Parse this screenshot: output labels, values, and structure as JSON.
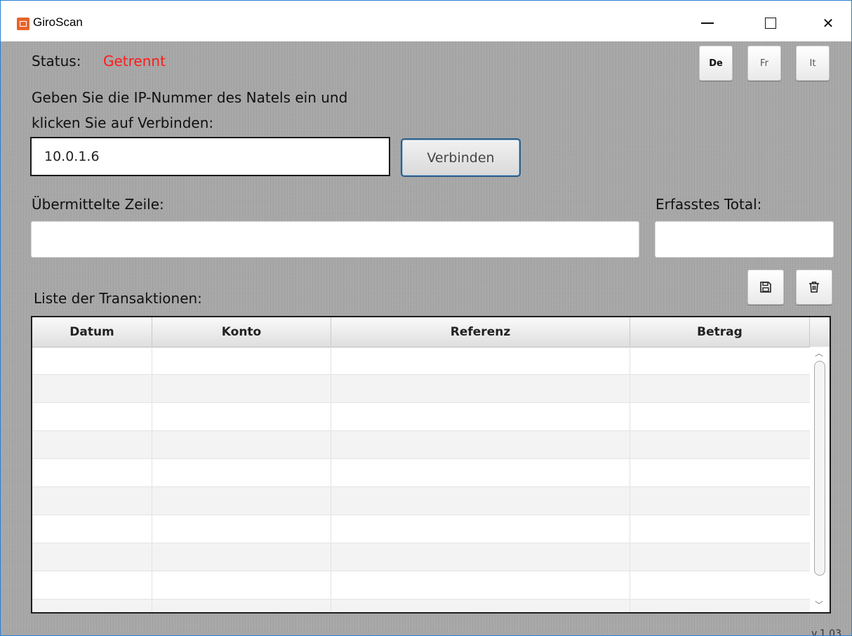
{
  "window": {
    "title": "GiroScan",
    "controls": {
      "minimize": "minimize",
      "maximize": "maximize",
      "close": "close"
    }
  },
  "status": {
    "label": "Status:",
    "value": "Getrennt",
    "value_color": "#ff1a1a"
  },
  "languages": [
    {
      "label": "De",
      "active": true
    },
    {
      "label": "Fr",
      "active": false
    },
    {
      "label": "It",
      "active": false
    }
  ],
  "instructions": {
    "line1": "Geben Sie die IP-Nummer des Natels ein und",
    "line2": "klicken Sie auf Verbinden:"
  },
  "ip_input": {
    "value": "10.0.1.6"
  },
  "connect_button": {
    "label": "Verbinden"
  },
  "transmitted_line": {
    "label": "Übermittelte Zeile:",
    "value": ""
  },
  "captured_total": {
    "label": "Erfasstes Total:",
    "value": ""
  },
  "transactions": {
    "label": "Liste der Transaktionen:",
    "columns": [
      "Datum",
      "Konto",
      "Referenz",
      "Betrag"
    ],
    "rows": []
  },
  "toolbar": {
    "save_icon": "save-icon",
    "delete_icon": "trash-icon"
  },
  "version": "v.1.03"
}
